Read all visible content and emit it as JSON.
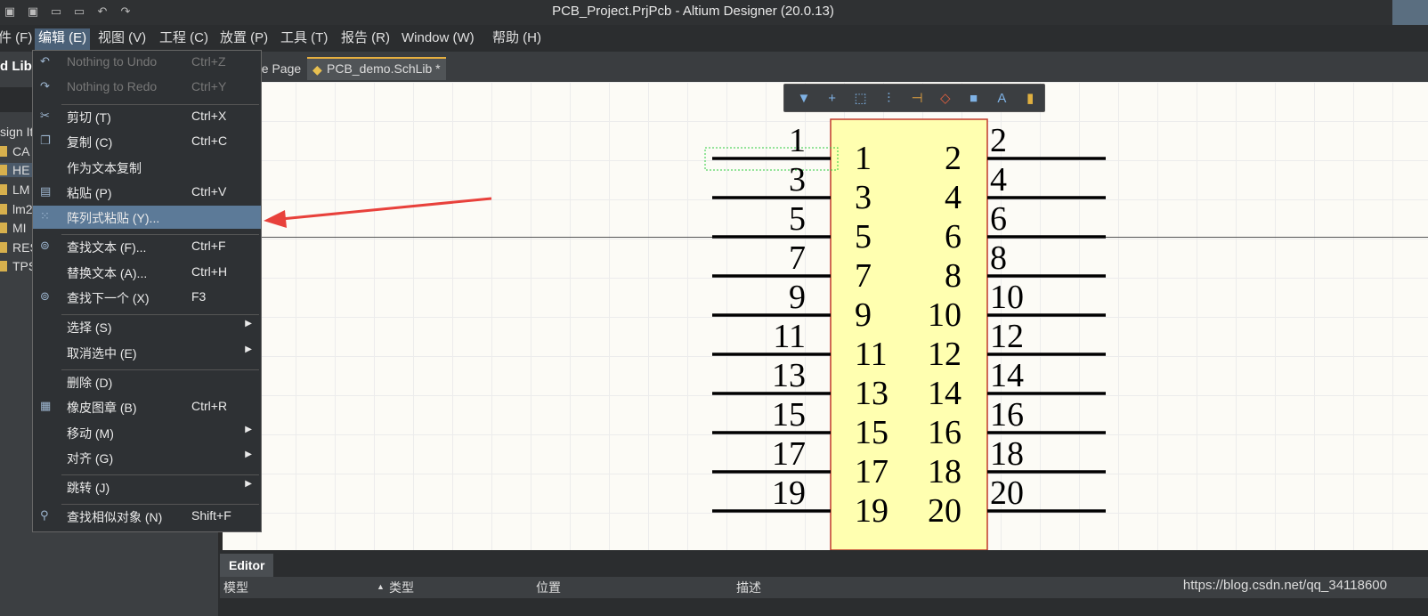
{
  "window": {
    "title": "PCB_Project.PrjPcb - Altium Designer (20.0.13)"
  },
  "menubar": [
    {
      "label": "件 (F)"
    },
    {
      "label": "编辑 (E)"
    },
    {
      "label": "视图 (V)"
    },
    {
      "label": "工程 (C)"
    },
    {
      "label": "放置 (P)"
    },
    {
      "label": "工具 (T)"
    },
    {
      "label": "报告 (R)"
    },
    {
      "label": "Window (W)"
    },
    {
      "label": "帮助 (H)"
    }
  ],
  "tabs": [
    {
      "label": "ne Page"
    },
    {
      "label": "PCB_demo.SchLib *"
    }
  ],
  "left_panel": {
    "header": "d Libra",
    "section_label": "sign It",
    "items": [
      "CA",
      "HE",
      "LM",
      "lm2",
      "MI",
      "RES",
      "TPS"
    ]
  },
  "edit_menu": [
    {
      "label": "Nothing to Undo",
      "shortcut": "Ctrl+Z",
      "icon": "undo-icon",
      "glyph": "↶",
      "disabled": true
    },
    {
      "label": "Nothing to Redo",
      "shortcut": "Ctrl+Y",
      "icon": "redo-icon",
      "glyph": "↷",
      "disabled": true
    },
    {
      "label": "剪切 (T)",
      "shortcut": "Ctrl+X",
      "icon": "scissors-icon",
      "glyph": "✂"
    },
    {
      "label": "复制 (C)",
      "shortcut": "Ctrl+C",
      "icon": "copy-icon",
      "glyph": "❐"
    },
    {
      "label": "作为文本复制",
      "shortcut": "",
      "icon": "",
      "glyph": ""
    },
    {
      "label": "粘贴 (P)",
      "shortcut": "Ctrl+V",
      "icon": "paste-icon",
      "glyph": "▤"
    },
    {
      "label": "阵列式粘贴 (Y)...",
      "shortcut": "",
      "icon": "array-paste-icon",
      "glyph": "⁙",
      "highlighted": true
    },
    {
      "label": "查找文本 (F)...",
      "shortcut": "Ctrl+F",
      "icon": "binoculars-icon",
      "glyph": "⊚"
    },
    {
      "label": "替换文本 (A)...",
      "shortcut": "Ctrl+H",
      "icon": "",
      "glyph": ""
    },
    {
      "label": "查找下一个 (X)",
      "shortcut": "F3",
      "icon": "find-next-icon",
      "glyph": "⊚"
    },
    {
      "label": "选择 (S)",
      "shortcut": "",
      "icon": "",
      "glyph": "",
      "submenu": true
    },
    {
      "label": "取消选中 (E)",
      "shortcut": "",
      "icon": "",
      "glyph": "",
      "submenu": true
    },
    {
      "label": "删除 (D)",
      "shortcut": "",
      "icon": "",
      "glyph": ""
    },
    {
      "label": "橡皮图章 (B)",
      "shortcut": "Ctrl+R",
      "icon": "rubber-stamp-icon",
      "glyph": "▦"
    },
    {
      "label": "移动 (M)",
      "shortcut": "",
      "icon": "",
      "glyph": "",
      "submenu": true
    },
    {
      "label": "对齐 (G)",
      "shortcut": "",
      "icon": "",
      "glyph": "",
      "submenu": true
    },
    {
      "label": "跳转 (J)",
      "shortcut": "",
      "icon": "",
      "glyph": "",
      "submenu": true
    },
    {
      "label": "查找相似对象 (N)",
      "shortcut": "Shift+F",
      "icon": "find-similar-icon",
      "glyph": "⚲"
    }
  ],
  "toolbar": [
    {
      "icon": "filter-icon",
      "glyph": "▼",
      "color": "#7fb2e5"
    },
    {
      "icon": "add-icon",
      "glyph": "+",
      "color": "#7fb2e5"
    },
    {
      "icon": "select-rect-icon",
      "glyph": "⬚",
      "color": "#7fb2e5"
    },
    {
      "icon": "align-icon",
      "glyph": "⫶",
      "color": "#7fb2e5"
    },
    {
      "icon": "pin-icon",
      "glyph": "⊣",
      "color": "#e0a040"
    },
    {
      "icon": "fill-icon",
      "glyph": "◇",
      "color": "#e06040"
    },
    {
      "icon": "rectangle-icon",
      "glyph": "■",
      "color": "#7fb2e5"
    },
    {
      "icon": "text-icon",
      "glyph": "A",
      "color": "#7fb2e5"
    },
    {
      "icon": "component-icon",
      "glyph": "▮",
      "color": "#e0b040"
    }
  ],
  "component": {
    "left_pins": [
      "1",
      "3",
      "5",
      "7",
      "9",
      "11",
      "13",
      "15",
      "17",
      "19"
    ],
    "right_pins": [
      "2",
      "4",
      "6",
      "8",
      "10",
      "12",
      "14",
      "16",
      "18",
      "20"
    ],
    "body_color": "#ffffb0",
    "border_color": "#c0392b"
  },
  "editor": {
    "tab": "Editor",
    "columns": [
      "模型",
      "类型",
      "位置",
      "描述"
    ]
  },
  "watermark": "https://blog.csdn.net/qq_34118600"
}
